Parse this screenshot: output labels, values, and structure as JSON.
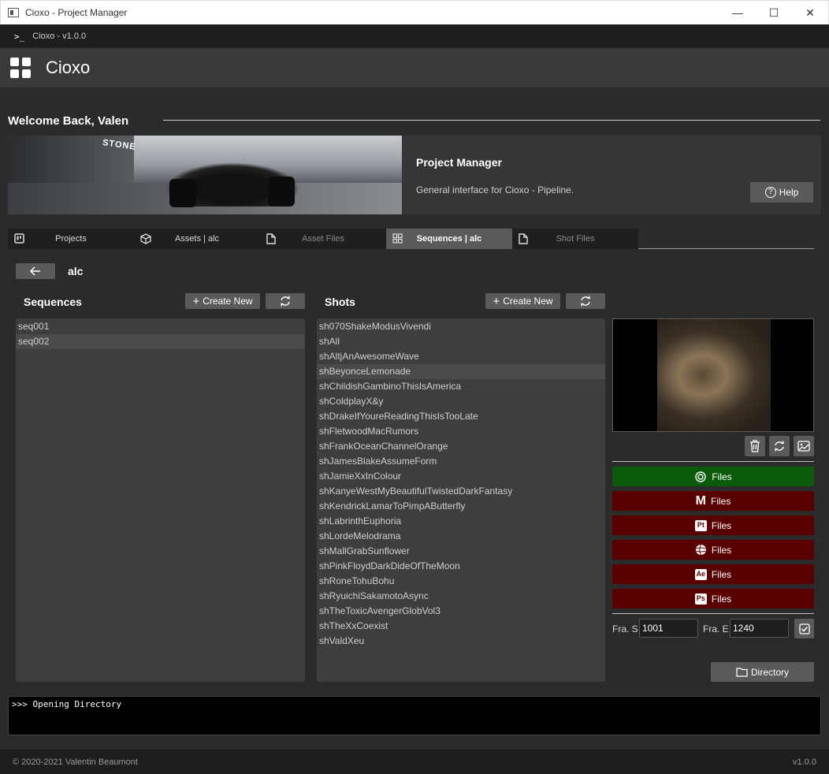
{
  "window": {
    "title": "Cioxo - Project Manager",
    "minimize": "—",
    "maximize": "☐",
    "close": "✕"
  },
  "app_bar": {
    "prompt": ">_",
    "label": "Cioxo  - v1.0.0"
  },
  "header": {
    "brand": "Cioxo"
  },
  "welcome": "Welcome Back, Valen",
  "banner": {
    "image_sign": "STONE",
    "title": "Project Manager",
    "subtitle": "General interface for Cioxo - Pipeline.",
    "help_label": "Help"
  },
  "tabs": [
    {
      "label": "Projects",
      "state": "normal",
      "icon": "board-icon"
    },
    {
      "label": "Assets | alc",
      "state": "normal",
      "icon": "cube-icon"
    },
    {
      "label": "Asset Files",
      "state": "inactive",
      "icon": "file-icon"
    },
    {
      "label": "Sequences | alc",
      "state": "active",
      "icon": "grid-icon"
    },
    {
      "label": "Shot Files",
      "state": "inactive",
      "icon": "file-icon"
    }
  ],
  "breadcrumb": "alc",
  "sequences": {
    "title": "Sequences",
    "create_label": "Create New",
    "items": [
      "seq001",
      "seq002"
    ],
    "selected": 1
  },
  "shots": {
    "title": "Shots",
    "create_label": "Create New",
    "selected": 3,
    "items": [
      "sh070ShakeModusVivendi",
      "shAll",
      "shAltjAnAwesomeWave",
      "shBeyonceLemonade",
      "shChildishGambinoThisIsAmerica",
      "shColdplayX&y",
      "shDrakeIfYoureReadingThisIsTooLate",
      "shFletwoodMacRumors",
      "shFrankOceanChannelOrange",
      "shJamesBlakeAssumeForm",
      "shJamieXxInColour",
      "shKanyeWestMyBeautifulTwistedDarkFantasy",
      "shKendrickLamarToPimpAButterfly",
      "shLabrinthEuphoria",
      "shLordeMelodrama",
      "shMallGrabSunflower",
      "shPinkFloydDarkDideOfTheMoon",
      "shRoneTohuBohu",
      "shRyuichiSakamotoAsync",
      "shTheToxicAvengerGlobVol3",
      "shTheXxCoexist",
      "shValdXeu"
    ]
  },
  "file_buttons": [
    {
      "app": "houdini",
      "badge": "",
      "label": "Files",
      "status": "green"
    },
    {
      "app": "maya",
      "badge": "M",
      "label": "Files",
      "status": "red"
    },
    {
      "app": "substance-painter",
      "badge": "Pt",
      "label": "Files",
      "status": "red"
    },
    {
      "app": "blender",
      "badge": "",
      "label": "Files",
      "status": "red"
    },
    {
      "app": "after-effects",
      "badge": "Ae",
      "label": "Files",
      "status": "red"
    },
    {
      "app": "photoshop",
      "badge": "Ps",
      "label": "Files",
      "status": "red"
    }
  ],
  "frames": {
    "start_label": "Fra. S",
    "start_value": "1001",
    "end_label": "Fra. E",
    "end_value": "1240"
  },
  "directory_label": "Directory",
  "console": ">>> Opening Directory",
  "footer": {
    "copyright": "© 2020-2021 Valentin Beaumont",
    "version": "v1.0.0"
  },
  "colors": {
    "files_green": "#0a5a0a",
    "files_red": "#5a0000",
    "active_tab": "#5a5a5a"
  }
}
